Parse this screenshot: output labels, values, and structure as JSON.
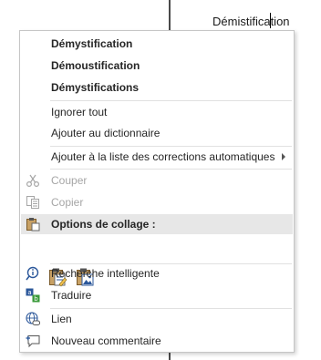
{
  "document": {
    "word": "Démistification"
  },
  "menu": {
    "suggestions": [
      "Démystification",
      "Démoustification",
      "Démystifications"
    ],
    "ignore_all": "Ignorer tout",
    "add_dictionary": "Ajouter au dictionnaire",
    "add_autocorrect": "Ajouter à la liste des corrections automatiques",
    "cut": "Couper",
    "copy": "Copier",
    "paste_options": "Options de collage :",
    "smart_lookup": "Recherche intelligente",
    "translate": "Traduire",
    "link": "Lien",
    "new_comment": "Nouveau commentaire"
  },
  "colors": {
    "accent": "#2b579a",
    "disabled_text": "#a6a6a6",
    "header_bg": "#e7e7e7",
    "spelling_error": "#e81123"
  },
  "icons": {
    "cut": "scissors-icon",
    "copy": "copy-icon",
    "paste": "clipboard-icon",
    "paste_keep_formatting": "paste-keep-formatting-icon",
    "paste_picture": "paste-picture-icon",
    "smart_lookup": "smart-lookup-icon",
    "translate": "translate-icon",
    "link": "globe-link-icon",
    "comment": "comment-icon"
  }
}
